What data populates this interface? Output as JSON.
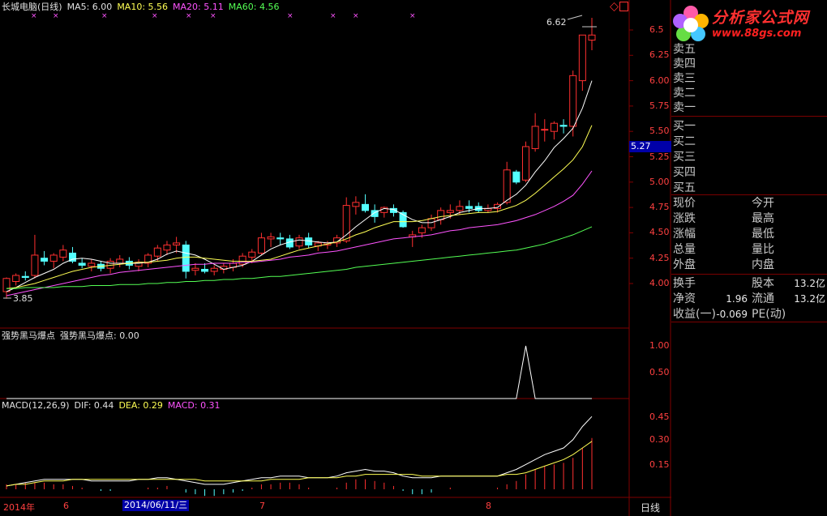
{
  "title": "长城电脑(日线)",
  "ma": {
    "ma5_label": "MA5: 6.00",
    "ma10_label": "MA10: 5.56",
    "ma20_label": "MA20: 5.11",
    "ma60_label": "MA60: 4.56"
  },
  "annotations": {
    "high": "6.62",
    "low": "3.85"
  },
  "price_axis": [
    "6.5",
    "6.25",
    "6.00",
    "5.75",
    "5.50",
    "5.25",
    "5.00",
    "4.75",
    "4.50",
    "4.25",
    "4.00"
  ],
  "current_price": "5.27",
  "indicator1": {
    "name": "强势黑马爆点",
    "value_label": "强势黑马爆点: 0.00",
    "axis": [
      "1.00",
      "0.50"
    ]
  },
  "macd": {
    "name": "MACD(12,26,9)",
    "dif_label": "DIF: 0.44",
    "dea_label": "DEA: 0.29",
    "macd_label": "MACD: 0.31",
    "axis": [
      "0.45",
      "0.30",
      "0.15"
    ]
  },
  "time_axis": {
    "year": "2014年",
    "m6": "6",
    "cursor_date": "2014/06/11/三",
    "m7": "7",
    "m8": "8",
    "period": "日线"
  },
  "orderbook": {
    "sell": [
      "卖五",
      "卖四",
      "卖三",
      "卖二",
      "卖一"
    ],
    "buy": [
      "买一",
      "买二",
      "买三",
      "买四",
      "买五"
    ]
  },
  "quote": {
    "rows": [
      [
        "现价",
        "今开"
      ],
      [
        "涨跌",
        "最高"
      ],
      [
        "涨幅",
        "最低"
      ],
      [
        "总量",
        "量比"
      ],
      [
        "外盘",
        "内盘"
      ]
    ],
    "stats": {
      "huanshou": "换手",
      "guben": "股本",
      "guben_val": "13.2亿",
      "jingzi": "净资",
      "jingzi_val": "1.96",
      "liutong": "流通",
      "liutong_val": "13.2亿",
      "shouyi": "收益(一)",
      "shouyi_val": "-0.069",
      "pe": "PE(动)"
    }
  },
  "logo": {
    "name": "分析家公式网",
    "url": "www.88gs.com"
  },
  "colors": {
    "up": "#ff3030",
    "down": "#54ffff",
    "ma5": "#ffffff",
    "ma10": "#ffff54",
    "ma20": "#ff54ff",
    "ma60": "#54ff54",
    "grid": "#800000"
  },
  "chart_data": {
    "type": "candlestick",
    "ohlc": [
      [
        3.92,
        4.06,
        3.85,
        4.05
      ],
      [
        4.02,
        4.1,
        3.98,
        4.08
      ],
      [
        4.07,
        4.12,
        4.03,
        4.06
      ],
      [
        4.08,
        4.48,
        4.05,
        4.28
      ],
      [
        4.25,
        4.32,
        4.18,
        4.22
      ],
      [
        4.22,
        4.3,
        4.15,
        4.28
      ],
      [
        4.26,
        4.38,
        4.22,
        4.33
      ],
      [
        4.3,
        4.36,
        4.2,
        4.22
      ],
      [
        4.2,
        4.25,
        4.15,
        4.18
      ],
      [
        4.17,
        4.24,
        4.12,
        4.2
      ],
      [
        4.19,
        4.22,
        4.12,
        4.15
      ],
      [
        4.15,
        4.25,
        4.1,
        4.22
      ],
      [
        4.2,
        4.28,
        4.16,
        4.24
      ],
      [
        4.22,
        4.26,
        4.14,
        4.18
      ],
      [
        4.17,
        4.24,
        4.12,
        4.21
      ],
      [
        4.2,
        4.3,
        4.16,
        4.28
      ],
      [
        4.27,
        4.38,
        4.22,
        4.35
      ],
      [
        4.33,
        4.42,
        4.28,
        4.38
      ],
      [
        4.38,
        4.46,
        4.3,
        4.4
      ],
      [
        4.38,
        4.42,
        4.05,
        4.12
      ],
      [
        4.13,
        4.2,
        4.08,
        4.15
      ],
      [
        4.14,
        4.2,
        4.1,
        4.12
      ],
      [
        4.12,
        4.18,
        4.08,
        4.15
      ],
      [
        4.14,
        4.2,
        4.1,
        4.17
      ],
      [
        4.16,
        4.24,
        4.12,
        4.2
      ],
      [
        4.19,
        4.3,
        4.16,
        4.27
      ],
      [
        4.26,
        4.34,
        4.2,
        4.31
      ],
      [
        4.3,
        4.5,
        4.28,
        4.45
      ],
      [
        4.44,
        4.5,
        4.36,
        4.46
      ],
      [
        4.45,
        4.5,
        4.38,
        4.44
      ],
      [
        4.44,
        4.48,
        4.34,
        4.36
      ],
      [
        4.37,
        4.48,
        4.34,
        4.45
      ],
      [
        4.45,
        4.5,
        4.35,
        4.38
      ],
      [
        4.37,
        4.42,
        4.32,
        4.4
      ],
      [
        4.38,
        4.42,
        4.34,
        4.4
      ],
      [
        4.4,
        4.48,
        4.36,
        4.45
      ],
      [
        4.42,
        4.85,
        4.4,
        4.77
      ],
      [
        4.76,
        4.86,
        4.68,
        4.8
      ],
      [
        4.78,
        4.88,
        4.7,
        4.72
      ],
      [
        4.72,
        4.78,
        4.6,
        4.66
      ],
      [
        4.7,
        4.76,
        4.65,
        4.75
      ],
      [
        4.74,
        4.78,
        4.66,
        4.7
      ],
      [
        4.7,
        4.72,
        4.55,
        4.56
      ],
      [
        4.46,
        4.52,
        4.36,
        4.48
      ],
      [
        4.5,
        4.58,
        4.45,
        4.55
      ],
      [
        4.55,
        4.68,
        4.52,
        4.64
      ],
      [
        4.63,
        4.75,
        4.58,
        4.72
      ],
      [
        4.7,
        4.78,
        4.64,
        4.72
      ],
      [
        4.72,
        4.82,
        4.68,
        4.76
      ],
      [
        4.76,
        4.82,
        4.7,
        4.74
      ],
      [
        4.76,
        4.8,
        4.7,
        4.72
      ],
      [
        4.72,
        4.78,
        4.7,
        4.74
      ],
      [
        4.74,
        4.8,
        4.7,
        4.78
      ],
      [
        4.8,
        5.2,
        4.78,
        5.12
      ],
      [
        5.1,
        5.12,
        4.98,
        5.0
      ],
      [
        5.02,
        5.4,
        5.0,
        5.35
      ],
      [
        5.33,
        5.68,
        5.3,
        5.55
      ],
      [
        5.52,
        5.62,
        5.4,
        5.52
      ],
      [
        5.5,
        5.6,
        5.42,
        5.58
      ],
      [
        5.56,
        5.62,
        5.48,
        5.55
      ],
      [
        5.55,
        6.1,
        5.45,
        6.05
      ],
      [
        6.0,
        6.2,
        5.9,
        6.45
      ],
      [
        6.4,
        6.62,
        6.3,
        6.45
      ]
    ],
    "ma5": [
      3.92,
      3.96,
      4.01,
      4.06,
      4.1,
      4.14,
      4.2,
      4.24,
      4.25,
      4.24,
      4.22,
      4.2,
      4.2,
      4.2,
      4.2,
      4.21,
      4.24,
      4.29,
      4.32,
      4.3,
      4.28,
      4.24,
      4.19,
      4.14,
      4.16,
      4.18,
      4.22,
      4.28,
      4.34,
      4.38,
      4.41,
      4.43,
      4.42,
      4.41,
      4.4,
      4.41,
      4.48,
      4.56,
      4.63,
      4.7,
      4.74,
      4.73,
      4.68,
      4.63,
      4.6,
      4.6,
      4.63,
      4.66,
      4.7,
      4.72,
      4.74,
      4.74,
      4.75,
      4.82,
      4.88,
      4.97,
      5.1,
      5.21,
      5.34,
      5.43,
      5.53,
      5.73,
      6.0
    ],
    "ma10": [
      3.95,
      3.96,
      3.98,
      4.0,
      4.03,
      4.06,
      4.09,
      4.12,
      4.14,
      4.16,
      4.17,
      4.18,
      4.19,
      4.2,
      4.21,
      4.21,
      4.22,
      4.23,
      4.25,
      4.26,
      4.26,
      4.25,
      4.24,
      4.23,
      4.22,
      4.22,
      4.22,
      4.23,
      4.24,
      4.27,
      4.3,
      4.33,
      4.35,
      4.37,
      4.39,
      4.41,
      4.44,
      4.48,
      4.51,
      4.55,
      4.58,
      4.61,
      4.61,
      4.61,
      4.62,
      4.64,
      4.66,
      4.67,
      4.68,
      4.69,
      4.7,
      4.7,
      4.71,
      4.74,
      4.77,
      4.82,
      4.89,
      4.97,
      5.05,
      5.13,
      5.22,
      5.35,
      5.56
    ],
    "ma20": [
      3.88,
      3.9,
      3.92,
      3.94,
      3.96,
      3.98,
      4.0,
      4.02,
      4.04,
      4.06,
      4.08,
      4.09,
      4.11,
      4.12,
      4.13,
      4.14,
      4.15,
      4.16,
      4.17,
      4.18,
      4.19,
      4.19,
      4.2,
      4.2,
      4.2,
      4.21,
      4.21,
      4.22,
      4.23,
      4.24,
      4.26,
      4.27,
      4.28,
      4.3,
      4.31,
      4.32,
      4.34,
      4.36,
      4.38,
      4.4,
      4.42,
      4.44,
      4.45,
      4.46,
      4.47,
      4.48,
      4.5,
      4.52,
      4.53,
      4.55,
      4.56,
      4.57,
      4.58,
      4.6,
      4.62,
      4.65,
      4.68,
      4.72,
      4.76,
      4.81,
      4.87,
      4.98,
      5.11
    ],
    "ma60": [
      3.95,
      3.95,
      3.96,
      3.96,
      3.96,
      3.96,
      3.97,
      3.97,
      3.97,
      3.98,
      3.98,
      3.98,
      3.99,
      3.99,
      3.99,
      4.0,
      4.0,
      4.01,
      4.01,
      4.02,
      4.02,
      4.03,
      4.03,
      4.04,
      4.04,
      4.05,
      4.05,
      4.06,
      4.07,
      4.07,
      4.08,
      4.09,
      4.1,
      4.11,
      4.12,
      4.13,
      4.14,
      4.16,
      4.17,
      4.18,
      4.19,
      4.2,
      4.21,
      4.22,
      4.23,
      4.24,
      4.25,
      4.26,
      4.27,
      4.28,
      4.29,
      4.3,
      4.31,
      4.32,
      4.33,
      4.35,
      4.37,
      4.39,
      4.42,
      4.45,
      4.48,
      4.52,
      4.56
    ],
    "signal": [
      0,
      0,
      0,
      0,
      0,
      0,
      0,
      0,
      0,
      0,
      0,
      0,
      0,
      0,
      0,
      0,
      0,
      0,
      0,
      0,
      0,
      0,
      0,
      0,
      0,
      0,
      0,
      0,
      0,
      0,
      0,
      0,
      0,
      0,
      0,
      0,
      0,
      0,
      0,
      0,
      0,
      0,
      0,
      0,
      0,
      0,
      0,
      0,
      0,
      0,
      0,
      0,
      0,
      0,
      0,
      1,
      0,
      0,
      0,
      0,
      0,
      0,
      0
    ],
    "dif": [
      0.02,
      0.03,
      0.04,
      0.05,
      0.06,
      0.06,
      0.06,
      0.06,
      0.06,
      0.05,
      0.05,
      0.05,
      0.05,
      0.05,
      0.06,
      0.06,
      0.07,
      0.07,
      0.06,
      0.05,
      0.04,
      0.03,
      0.03,
      0.03,
      0.04,
      0.05,
      0.06,
      0.07,
      0.07,
      0.08,
      0.08,
      0.08,
      0.07,
      0.07,
      0.07,
      0.08,
      0.1,
      0.11,
      0.12,
      0.11,
      0.11,
      0.1,
      0.08,
      0.07,
      0.07,
      0.07,
      0.08,
      0.08,
      0.08,
      0.08,
      0.08,
      0.08,
      0.08,
      0.1,
      0.12,
      0.15,
      0.18,
      0.21,
      0.23,
      0.25,
      0.3,
      0.38,
      0.44
    ],
    "dea": [
      0.02,
      0.03,
      0.03,
      0.04,
      0.05,
      0.05,
      0.05,
      0.06,
      0.06,
      0.06,
      0.06,
      0.06,
      0.06,
      0.06,
      0.06,
      0.06,
      0.06,
      0.06,
      0.06,
      0.06,
      0.06,
      0.05,
      0.05,
      0.05,
      0.05,
      0.05,
      0.05,
      0.05,
      0.06,
      0.06,
      0.06,
      0.06,
      0.07,
      0.07,
      0.07,
      0.07,
      0.08,
      0.08,
      0.09,
      0.09,
      0.09,
      0.09,
      0.09,
      0.09,
      0.08,
      0.08,
      0.08,
      0.08,
      0.08,
      0.08,
      0.08,
      0.08,
      0.08,
      0.09,
      0.09,
      0.1,
      0.12,
      0.14,
      0.16,
      0.18,
      0.21,
      0.25,
      0.29
    ],
    "macd_hist": [
      0.03,
      0.03,
      0.04,
      0.04,
      0.04,
      0.03,
      0.03,
      0.02,
      0.01,
      0.0,
      -0.01,
      -0.01,
      0.0,
      0.0,
      0.0,
      0.01,
      0.01,
      0.02,
      0.0,
      -0.02,
      -0.03,
      -0.04,
      -0.04,
      -0.03,
      -0.02,
      -0.01,
      0.01,
      0.03,
      0.03,
      0.04,
      0.04,
      0.03,
      0.01,
      0.0,
      0.0,
      0.01,
      0.04,
      0.06,
      0.06,
      0.05,
      0.04,
      0.02,
      -0.01,
      -0.03,
      -0.03,
      -0.02,
      0.0,
      0.01,
      0.0,
      0.0,
      0.0,
      0.0,
      0.01,
      0.03,
      0.05,
      0.09,
      0.12,
      0.14,
      0.15,
      0.16,
      0.19,
      0.25,
      0.31
    ]
  }
}
